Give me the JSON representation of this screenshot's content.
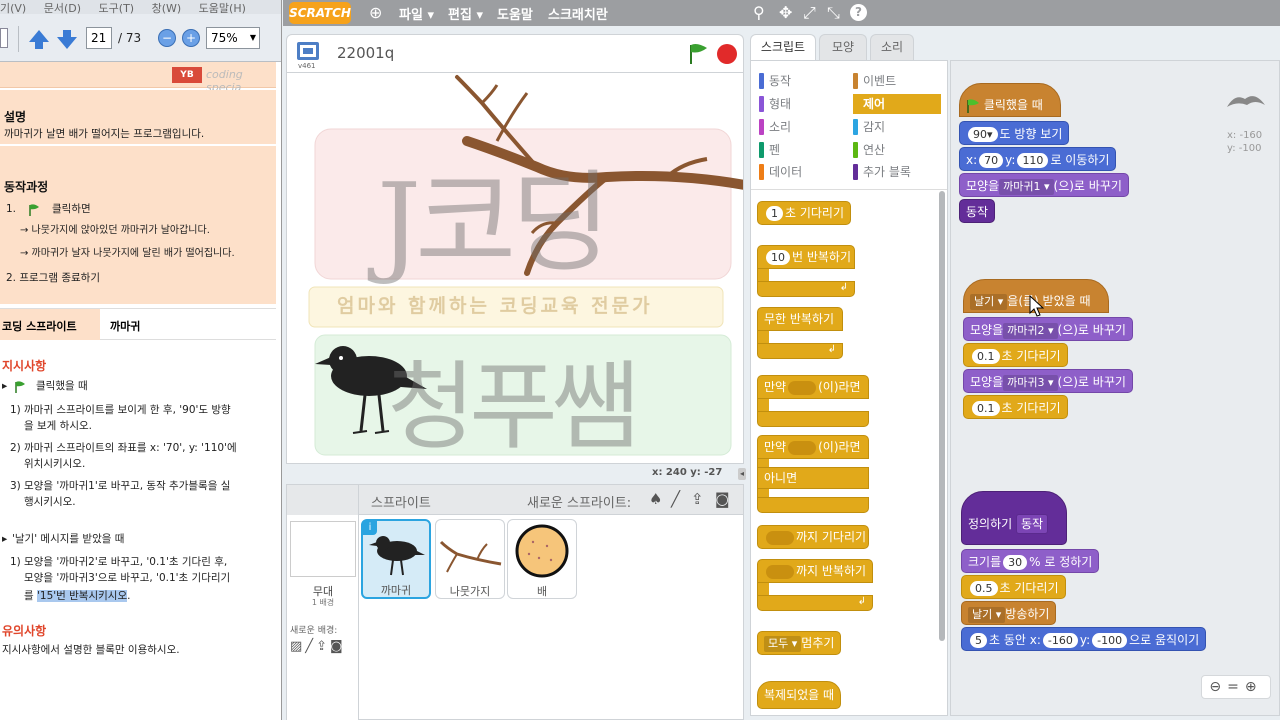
{
  "pdf": {
    "menu": [
      "기(V)",
      "문서(D)",
      "도구(T)",
      "창(W)",
      "도움말(H)"
    ],
    "page_current": "21",
    "page_total": "/ 73",
    "zoom": "75%",
    "logo_text": "coding specia",
    "desc_title": "설명",
    "desc_text": "까마귀가 날면 배가 떨어지는 프로그램입니다.",
    "steps_title": "동작과정",
    "step1_num": "1.",
    "step1_text": "클릭하면",
    "step1_sub1": "→ 나뭇가지에 앉아있던 까마귀가 날아갑니다.",
    "step1_sub2": "→ 까마귀가 날자 나뭇가지에 달린 배가 떨어집니다.",
    "step2_text": "2.  프로그램 종료하기",
    "table_left": "코딩 스프라이트",
    "table_right": "까마귀",
    "instr_title": "지시사항",
    "instr_click": "클릭했을 때",
    "instr_1a_num": "1)",
    "instr_1a": "까마귀 스프라이트를 보이게 한 후, '90'도 방향",
    "instr_1b": "을 보게 하시오.",
    "instr_2a_num": "2)",
    "instr_2a": "까마귀 스프라이트의 좌표를 x: '70', y: '110'에",
    "instr_2b": "위치시키시오.",
    "instr_3a_num": "3)",
    "instr_3a": "모양을 '까마귀1'로 바꾸고, 동작 추가블록을 실",
    "instr_3b": "행시키시오.",
    "instr_msg": "'날기' 메시지를 받았을 때",
    "instr_m1a_num": "1)",
    "instr_m1a": "모양을 '까마귀2'로 바꾸고, '0.1'초 기다린 후,",
    "instr_m1b": "모양을 '까마귀3'으로 바꾸고, '0.1'초 기다리기",
    "instr_m1c_pre": "를",
    "instr_m1c_hl": "'15'번 반복시키시오",
    "instr_m1c_post": ".",
    "note_title": "유의사항",
    "note_text": "지시사항에서 설명한 블록만 이용하시오."
  },
  "scratch": {
    "logo": "SCRATCH",
    "menus": [
      "파일 ▾",
      "편집 ▾",
      "도움말",
      "스크래치란"
    ],
    "project_title": "22001q",
    "version": "v461",
    "coords": "x: 240  y: -27",
    "watermark_top": "J코딩",
    "watermark_mid": "엄마와 함께하는 코딩교육 전문가",
    "watermark_bot": "청푸쌤",
    "sprites_label": "스프라이트",
    "new_sprite_label": "새로운 스프라이트:",
    "stage_thumb_name": "무대",
    "stage_thumb_sub": "1 배경",
    "new_backdrop": "새로운 배경:",
    "sprites": [
      {
        "name": "까마귀"
      },
      {
        "name": "나뭇가지"
      },
      {
        "name": "배"
      }
    ],
    "tabs": [
      "스크립트",
      "모양",
      "소리"
    ],
    "categories_left": [
      {
        "label": "동작",
        "color": "#4a6cd4"
      },
      {
        "label": "형태",
        "color": "#8a55d7"
      },
      {
        "label": "소리",
        "color": "#bb42c3"
      },
      {
        "label": "펜",
        "color": "#0e9a6c"
      },
      {
        "label": "데이터",
        "color": "#ee7d16"
      }
    ],
    "categories_right": [
      {
        "label": "이벤트",
        "color": "#c88330"
      },
      {
        "label": "제어",
        "color": "#e1a91a"
      },
      {
        "label": "감지",
        "color": "#2ca5e2"
      },
      {
        "label": "연산",
        "color": "#5cb712"
      },
      {
        "label": "추가 블록",
        "color": "#632d99"
      }
    ],
    "palette": {
      "wait": "초 기다리기",
      "wait_val": "1",
      "repeat": "번 반복하기",
      "repeat_val": "10",
      "forever": "무한 반복하기",
      "if": "만약",
      "if_then": "(이)라면",
      "else": "아니면",
      "wait_until": "까지 기다리기",
      "repeat_until": "까지 반복하기",
      "stop": "모두",
      "stop_label": "멈추기",
      "clone_start": "복제되었을 때"
    },
    "sprite_xy": "x: -160\ny: -100",
    "script1": {
      "hat": "클릭했을 때",
      "point_val": "90▾",
      "point": "도 방향 보기",
      "goto_x": "x:",
      "goto_x_val": "70",
      "goto_y": "y:",
      "goto_y_val": "110",
      "goto_end": "로 이동하기",
      "costume": "모양을",
      "costume_val": "까마귀1",
      "costume_end": "(으)로 바꾸기",
      "custom": "동작"
    },
    "script2": {
      "msg": "날기",
      "hat_end": "을(를) 받았을 때",
      "c1": "모양을",
      "c1_val": "까마귀2",
      "c1_end": "(으)로 바꾸기",
      "w1_val": "0.1",
      "w1": "초 기다리기",
      "c2": "모양을",
      "c2_val": "까마귀3",
      "c2_end": "(으)로 바꾸기",
      "w2_val": "0.1",
      "w2": "초 기다리기"
    },
    "script3": {
      "define": "정의하기",
      "define_name": "동작",
      "size": "크기를",
      "size_val": "30",
      "size_end": "% 로 정하기",
      "wait_val": "0.5",
      "wait": "초 기다리기",
      "bcast": "날기",
      "bcast_end": "방송하기",
      "glide_val": "5",
      "glide": "초 동안 x:",
      "glide_x": "-160",
      "glide_y_label": "y:",
      "glide_y": "-100",
      "glide_end": "으로 움직이기"
    }
  }
}
